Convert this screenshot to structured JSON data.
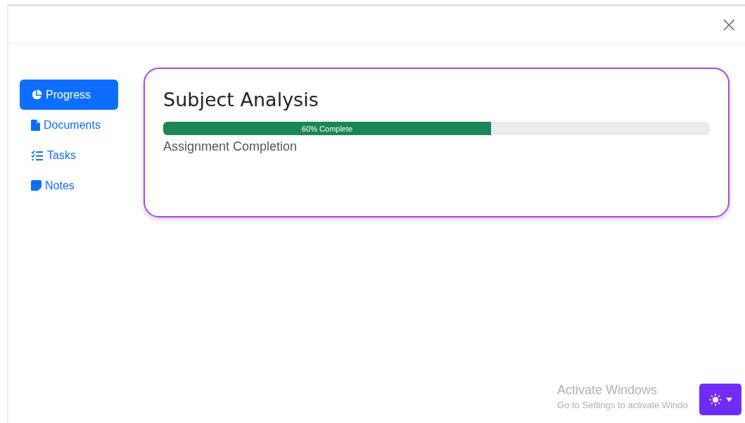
{
  "dialog": {
    "close_label": "×"
  },
  "sidebar": {
    "items": [
      {
        "label": "Progress",
        "kind": "chart",
        "selected": true
      },
      {
        "label": "Documents",
        "kind": "file",
        "selected": false
      },
      {
        "label": "Tasks",
        "kind": "list",
        "selected": false
      },
      {
        "label": "Notes",
        "kind": "note",
        "selected": false
      }
    ]
  },
  "card": {
    "title": "Subject Analysis",
    "progress": {
      "level": 0.6,
      "label": "60% Complete"
    },
    "caption": "Assignment Completion"
  },
  "os_notice": {
    "title": "Activate Windows",
    "text": "Go to Settings to activate Windo"
  },
  "theme_button": {
    "expanded": false
  }
}
